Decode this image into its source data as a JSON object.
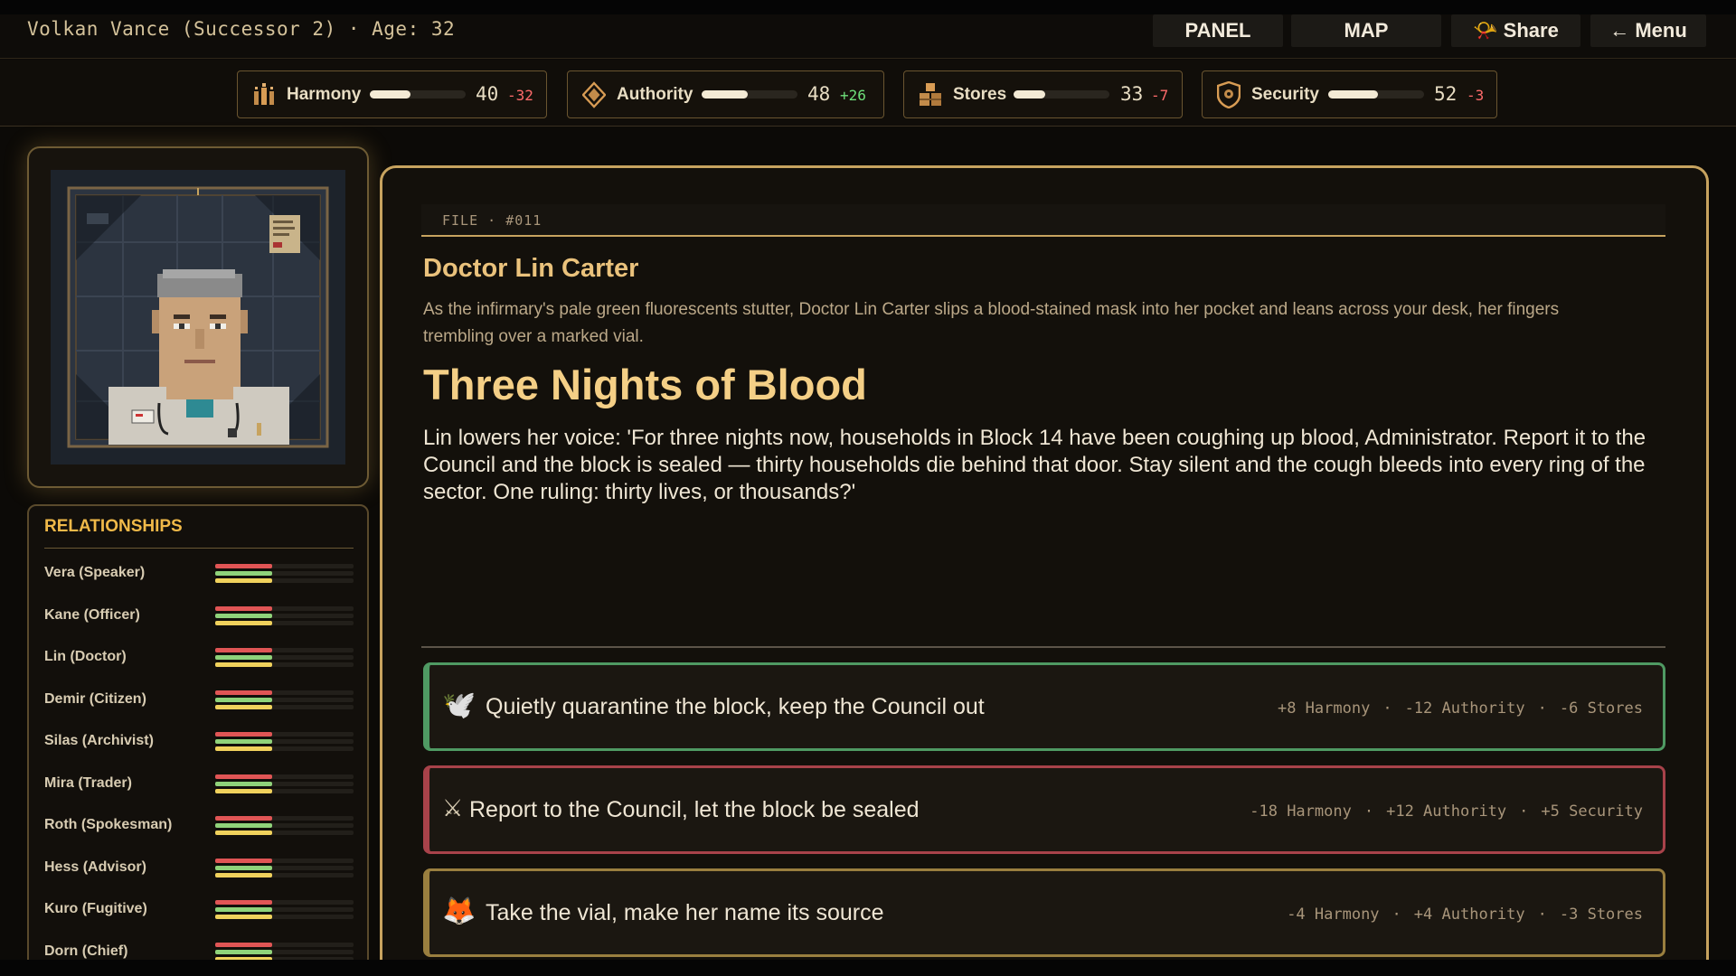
{
  "header": {
    "player_info": "Volkan Vance (Successor 2) · Age: 32",
    "buttons": {
      "panel": "PANEL",
      "map": "MAP",
      "share": "📯 Share",
      "menu": "← Menu"
    }
  },
  "stats": [
    {
      "name": "Harmony",
      "value": "40",
      "delta": "-32",
      "level": 0.42,
      "icon": "harmony-people-icon",
      "delta_color": "#ff6b6b"
    },
    {
      "name": "Authority",
      "value": "48",
      "delta": "+26",
      "level": 0.48,
      "icon": "authority-diamond-icon",
      "delta_color": "#6ee07a"
    },
    {
      "name": "Stores",
      "value": "33",
      "delta": "-7",
      "level": 0.33,
      "icon": "stores-crates-icon",
      "delta_color": "#ff6b6b"
    },
    {
      "name": "Security",
      "value": "52",
      "delta": "-3",
      "level": 0.52,
      "icon": "security-shield-icon",
      "delta_color": "#ff6b6b"
    }
  ],
  "relationships": {
    "title": "RELATIONSHIPS",
    "colors": {
      "red": "#e05555",
      "green": "#8fd27a",
      "yellow": "#f0d15c"
    },
    "items": [
      {
        "name": "Vera (Speaker)",
        "levels": [
          0.41,
          0.41,
          0.41
        ]
      },
      {
        "name": "Kane (Officer)",
        "levels": [
          0.41,
          0.41,
          0.41
        ]
      },
      {
        "name": "Lin (Doctor)",
        "levels": [
          0.41,
          0.41,
          0.41
        ]
      },
      {
        "name": "Demir (Citizen)",
        "levels": [
          0.41,
          0.41,
          0.41
        ]
      },
      {
        "name": "Silas (Archivist)",
        "levels": [
          0.41,
          0.41,
          0.41
        ]
      },
      {
        "name": "Mira (Trader)",
        "levels": [
          0.41,
          0.41,
          0.41
        ]
      },
      {
        "name": "Roth (Spokesman)",
        "levels": [
          0.41,
          0.41,
          0.41
        ]
      },
      {
        "name": "Hess (Advisor)",
        "levels": [
          0.41,
          0.41,
          0.41
        ]
      },
      {
        "name": "Kuro (Fugitive)",
        "levels": [
          0.41,
          0.41,
          0.41
        ]
      },
      {
        "name": "Dorn (Chief)",
        "levels": [
          0.41,
          0.41,
          0.41
        ]
      }
    ]
  },
  "event": {
    "file_tag": "FILE · #011",
    "character": "Doctor Lin Carter",
    "intro": "As the infirmary's pale green fluorescents stutter, Doctor Lin Carter slips a blood-stained mask into her pocket and leans across your desk, her fingers trembling over a marked vial.",
    "title": "Three Nights of Blood",
    "body": "Lin lowers her voice: 'For three nights now, households in Block 14 have been coughing up blood, Administrator. Report it to the Council and the block is sealed — thirty households die behind that door. Stay silent and the cough bleeds into every ring of the sector. One ruling: thirty lives, or thousands?'"
  },
  "choices": [
    {
      "icon": "🕊️",
      "icon_name": "dove-icon",
      "label": "Quietly quarantine the block, keep the Council out",
      "effects": [
        "+8 Harmony",
        "-12 Authority",
        "-6 Stores"
      ],
      "border": "#4f9a63"
    },
    {
      "icon": "⚔",
      "icon_name": "crossed-swords-icon",
      "label": "Report to the Council, let the block be sealed",
      "effects": [
        "-18 Harmony",
        "+12 Authority",
        "+5 Security"
      ],
      "border": "#a8424a"
    },
    {
      "icon": "🦊",
      "icon_name": "fox-icon",
      "label": "Take the vial, make her name its source",
      "effects": [
        "-4 Harmony",
        "+4 Authority",
        "-3 Stores"
      ],
      "border": "#9a7f3f"
    }
  ]
}
